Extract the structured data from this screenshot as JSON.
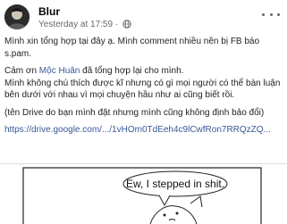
{
  "post": {
    "author": "Blur",
    "timestamp": "Yesterday at 17:59",
    "separator": "·",
    "visibility_icon": "globe-icon",
    "more_icon": "more-options-icon",
    "paragraphs": {
      "p1": "Mình xin tổng hợp tại đây ạ. Mình comment nhiều nên bị FB báo s.pam.",
      "p2_prefix": "Cảm ơn ",
      "p2_mention": "Mộc Huân",
      "p2_suffix": " đã tổng hợp lại cho mình.",
      "p2_line2": "Mình không chú thích được kĩ nhưng có gì mọi người có thể bàn luận bên dưới với nhau vì mọi chuyện hầu như ai cũng biết rồi.",
      "p3": "(tên Drive do bạn mình đặt nhưng mình cũng không định bảo đổi)",
      "link": "https://drive.google.com/.../1vHOm0TdEeh4c9lCwfRon7RRQzZQ..."
    },
    "image": {
      "speech_text": "Ew, I stepped in shit."
    }
  }
}
